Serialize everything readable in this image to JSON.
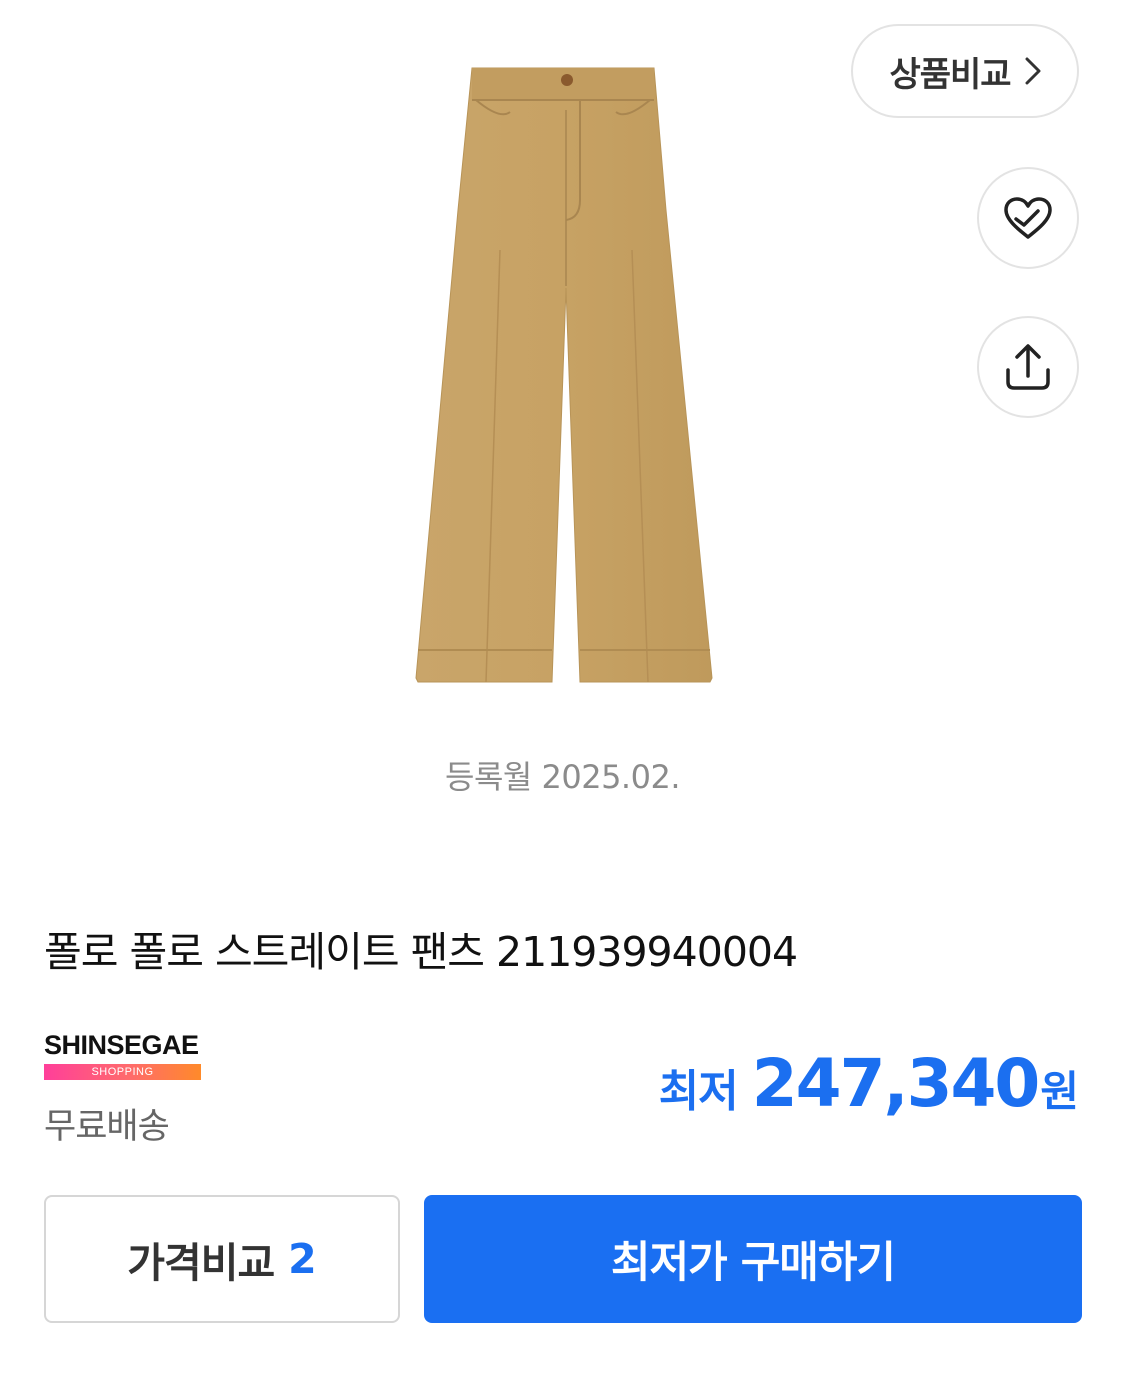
{
  "header": {
    "compare_products_label": "상품비교",
    "icons": [
      "chevron-right-icon",
      "heart-icon",
      "share-icon"
    ]
  },
  "product": {
    "image": "beige-wide-straight-pants",
    "registration_date": "등록월 2025.02.",
    "title": "폴로 폴로 스트레이트 팬츠 211939940004"
  },
  "seller": {
    "logo_text": "SHINSEGAE",
    "logo_sub": "SHOPPING",
    "shipping": "무료배송"
  },
  "price": {
    "prefix": "최저",
    "amount": "247,340",
    "unit": "원",
    "color": "#1B6FF0"
  },
  "actions": {
    "price_compare_label": "가격비교",
    "price_compare_count": "2",
    "buy_label": "최저가 구매하기",
    "buy_color": "#1A6FF2"
  }
}
